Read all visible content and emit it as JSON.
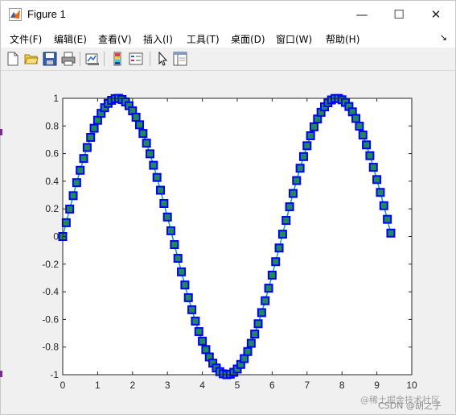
{
  "window": {
    "title": "Figure 1"
  },
  "window_controls": {
    "minimize": "—",
    "maximize": "☐",
    "close": "✕"
  },
  "menu": [
    {
      "label": "文件(F)"
    },
    {
      "label": "编辑(E)"
    },
    {
      "label": "查看(V)"
    },
    {
      "label": "插入(I)"
    },
    {
      "label": "工具(T)"
    },
    {
      "label": "桌面(D)"
    },
    {
      "label": "窗口(W)"
    },
    {
      "label": "帮助(H)"
    }
  ],
  "menu_overflow": "↘",
  "toolbar": [
    {
      "icon": "new-figure-icon"
    },
    {
      "icon": "open-file-icon"
    },
    {
      "icon": "save-icon"
    },
    {
      "icon": "print-icon"
    },
    {
      "icon": "link-plot-icon"
    },
    {
      "icon": "insert-colorbar-icon"
    },
    {
      "icon": "insert-legend-icon"
    },
    {
      "icon": "edit-plot-pointer-icon"
    },
    {
      "icon": "show-plot-tools-icon"
    }
  ],
  "watermark": "@稀土掘金技术社区",
  "watermark_overlay": "CSDN @胡之子",
  "chart_data": {
    "type": "line",
    "title": "",
    "xlabel": "",
    "ylabel": "",
    "xlim": [
      0,
      10
    ],
    "ylim": [
      -1,
      1
    ],
    "xticks": [
      "0",
      "1",
      "2",
      "3",
      "4",
      "5",
      "6",
      "7",
      "8",
      "9",
      "10"
    ],
    "yticks": [
      "-1",
      "-0.8",
      "-0.6",
      "-0.4",
      "-0.2",
      "0",
      "0.2",
      "0.4",
      "0.6",
      "0.8",
      "1"
    ],
    "grid": false,
    "series": [
      {
        "function": "sin(x)",
        "x_start": 0,
        "x_end": 9.4,
        "x_step": 0.1,
        "marker": "square",
        "marker_edge_color": "#0000ff",
        "marker_face_color": "#1f8a5a",
        "line_color": "#00aa99"
      }
    ]
  }
}
